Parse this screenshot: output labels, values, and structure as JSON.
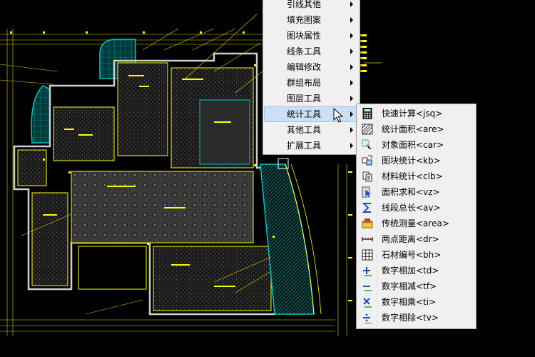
{
  "main_menu": {
    "items": [
      {
        "label": "引线其他",
        "has_submenu": true
      },
      {
        "label": "填充图案",
        "has_submenu": true
      },
      {
        "label": "图块属性",
        "has_submenu": true
      },
      {
        "label": "线条工具",
        "has_submenu": true
      },
      {
        "label": "编辑修改",
        "has_submenu": true
      },
      {
        "label": "群组布局",
        "has_submenu": true
      },
      {
        "label": "图层工具",
        "has_submenu": true
      },
      {
        "label": "统计工具",
        "has_submenu": true,
        "active": true
      },
      {
        "label": "其他工具",
        "has_submenu": true
      },
      {
        "label": "扩展工具",
        "has_submenu": true
      }
    ]
  },
  "sub_menu": {
    "items": [
      {
        "label": "快速计算<jsq>",
        "icon": "calculator-icon"
      },
      {
        "label": "统计面积<are>",
        "icon": "hatch-area-icon"
      },
      {
        "label": "对象面积<car>",
        "icon": "object-area-icon"
      },
      {
        "label": "图块统计<kb>",
        "icon": "block-count-icon"
      },
      {
        "label": "材料统计<clb>",
        "icon": "material-count-icon"
      },
      {
        "label": "面积求和<vz>",
        "icon": "area-sum-icon"
      },
      {
        "label": "线段总长<av>",
        "icon": "sigma-icon"
      },
      {
        "label": "传统测量<area>",
        "icon": "measure-icon"
      },
      {
        "label": "两点距离<dr>",
        "icon": "distance-icon"
      },
      {
        "label": "石材编号<bh>",
        "icon": "grid-number-icon"
      },
      {
        "label": "数字相加<td>",
        "icon": "plus-icon"
      },
      {
        "label": "数字相减<tf>",
        "icon": "minus-icon"
      },
      {
        "label": "数字相乘<ti>",
        "icon": "multiply-icon"
      },
      {
        "label": "数字相除<tv>",
        "icon": "divide-icon"
      }
    ]
  },
  "colors": {
    "cad_background": "#000000",
    "cad_line_yellow": "#ffff00",
    "cad_line_cyan": "#00c8c8",
    "menu_background": "#f0f0f0",
    "menu_highlight": "#cce0f5"
  }
}
